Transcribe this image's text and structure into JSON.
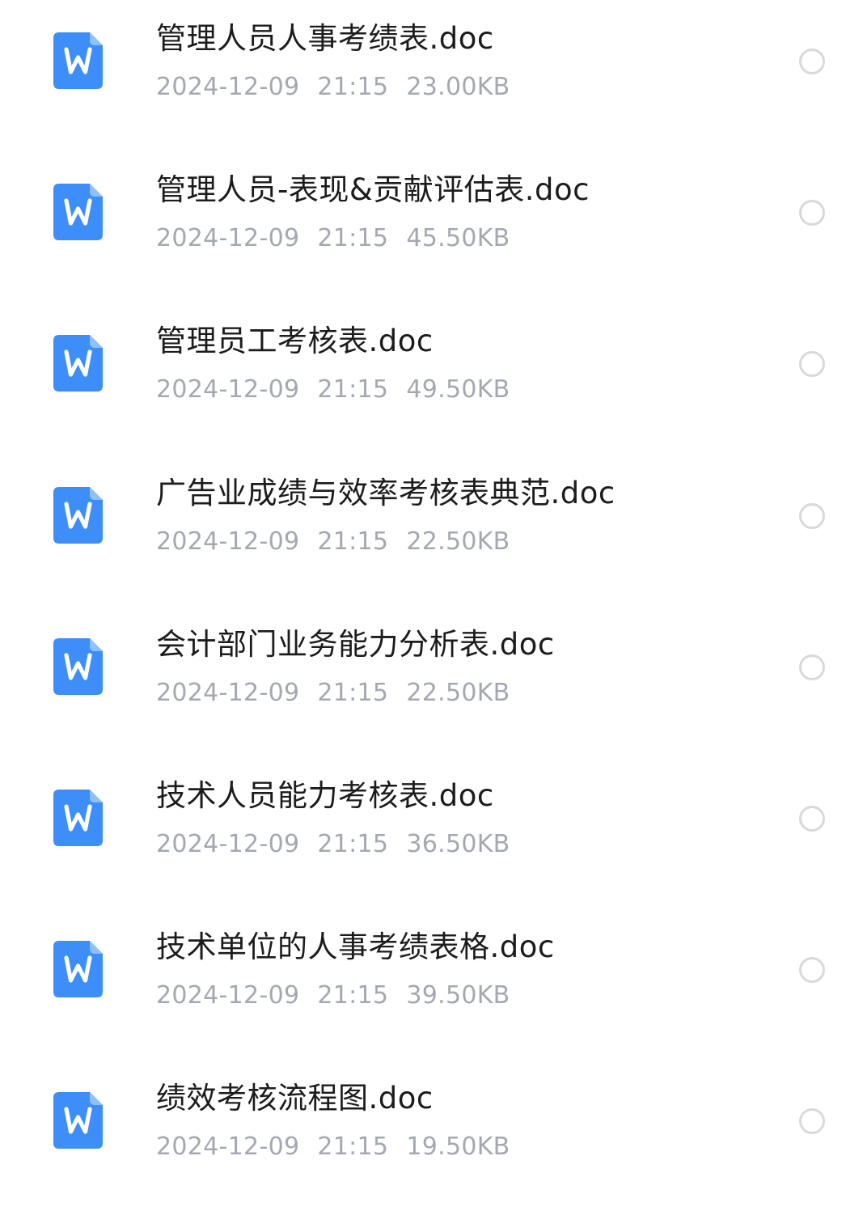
{
  "colors": {
    "doc_icon_blue": "#3d8ef8",
    "doc_icon_fold": "#8ec0fb",
    "meta_text": "#a4a8b0",
    "radio_border": "#d9d9d9"
  },
  "files": [
    {
      "icon": "word-doc-icon",
      "name": "管理人员人事考绩表.doc",
      "date": "2024-12-09",
      "time": "21:15",
      "size": "23.00KB",
      "selected": false
    },
    {
      "icon": "word-doc-icon",
      "name": "管理人员-表现&贡献评估表.doc",
      "date": "2024-12-09",
      "time": "21:15",
      "size": "45.50KB",
      "selected": false
    },
    {
      "icon": "word-doc-icon",
      "name": "管理员工考核表.doc",
      "date": "2024-12-09",
      "time": "21:15",
      "size": "49.50KB",
      "selected": false
    },
    {
      "icon": "word-doc-icon",
      "name": "广告业成绩与效率考核表典范.doc",
      "date": "2024-12-09",
      "time": "21:15",
      "size": "22.50KB",
      "selected": false
    },
    {
      "icon": "word-doc-icon",
      "name": "会计部门业务能力分析表.doc",
      "date": "2024-12-09",
      "time": "21:15",
      "size": "22.50KB",
      "selected": false
    },
    {
      "icon": "word-doc-icon",
      "name": "技术人员能力考核表.doc",
      "date": "2024-12-09",
      "time": "21:15",
      "size": "36.50KB",
      "selected": false
    },
    {
      "icon": "word-doc-icon",
      "name": "技术单位的人事考绩表格.doc",
      "date": "2024-12-09",
      "time": "21:15",
      "size": "39.50KB",
      "selected": false
    },
    {
      "icon": "word-doc-icon",
      "name": "绩效考核流程图.doc",
      "date": "2024-12-09",
      "time": "21:15",
      "size": "19.50KB",
      "selected": false
    }
  ]
}
